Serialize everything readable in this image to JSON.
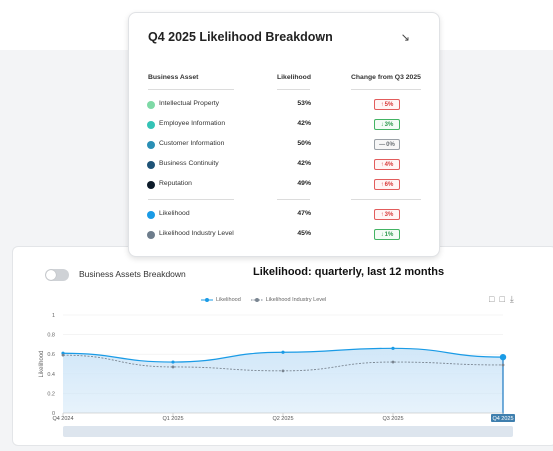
{
  "card": {
    "title": "Q4 2025 Likelihood Breakdown",
    "columns": {
      "asset": "Business Asset",
      "likelihood": "Likelihood",
      "change": "Change from Q3 2025"
    },
    "rows": [
      {
        "label": "Intellectual Property",
        "value": "53%",
        "change": "5%",
        "dir": "up",
        "color": "#7ed9a6"
      },
      {
        "label": "Employee Information",
        "value": "42%",
        "change": "3%",
        "dir": "down",
        "color": "#34c3b6"
      },
      {
        "label": "Customer Information",
        "value": "50%",
        "change": "0%",
        "dir": "flat",
        "color": "#2a8fb5"
      },
      {
        "label": "Business Continuity",
        "value": "42%",
        "change": "4%",
        "dir": "up",
        "color": "#1f5377"
      },
      {
        "label": "Reputation",
        "value": "49%",
        "change": "6%",
        "dir": "up",
        "color": "#0d1b2a"
      }
    ],
    "summary": [
      {
        "label": "Likelihood",
        "value": "47%",
        "change": "3%",
        "dir": "up",
        "color": "#1a9be6"
      },
      {
        "label": "Likelihood Industry Level",
        "value": "45%",
        "change": "1%",
        "dir": "down",
        "color": "#6e7d8c"
      }
    ]
  },
  "panel": {
    "toggle_label": "Business Assets Breakdown",
    "title": "Likelihood: quarterly, last 12 months",
    "tools": [
      "restore-icon",
      "zoom-reset-icon",
      "download-icon"
    ]
  },
  "colors": {
    "likelihood": "#1a9be6",
    "industry": "#7a8591",
    "area": "#cfe6f8"
  },
  "chart_data": {
    "type": "area",
    "x": [
      "Q4 2024",
      "Q1 2025",
      "Q2 2025",
      "Q3 2025",
      "Q4 2025"
    ],
    "ylabel": "Likelihood",
    "ylim": [
      0,
      1
    ],
    "yticks": [
      "0",
      "0.2",
      "0.4",
      "0.6",
      "0.8",
      "1"
    ],
    "grid": true,
    "legend_position": "top",
    "series": [
      {
        "name": "Likelihood",
        "values": [
          0.61,
          0.52,
          0.62,
          0.66,
          0.57
        ]
      },
      {
        "name": "Likelihood Industry Level",
        "values": [
          0.59,
          0.47,
          0.43,
          0.52,
          0.49
        ]
      }
    ]
  }
}
